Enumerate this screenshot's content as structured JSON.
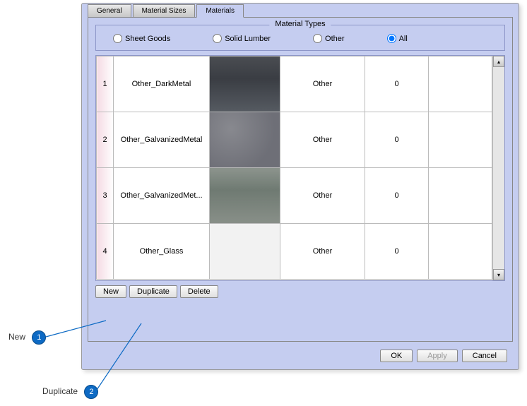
{
  "tabs": {
    "general": "General",
    "sizes": "Material Sizes",
    "materials": "Materials"
  },
  "activeTab": "materials",
  "materialTypes": {
    "legend": "Material Types",
    "options": {
      "sheet": "Sheet Goods",
      "solid": "Solid Lumber",
      "other": "Other",
      "all": "All"
    },
    "selected": "all"
  },
  "rows": [
    {
      "num": "1",
      "name": "Other_DarkMetal",
      "type": "Other",
      "value": "0",
      "swatchClass": "sw1"
    },
    {
      "num": "2",
      "name": "Other_GalvanizedMetal",
      "type": "Other",
      "value": "0",
      "swatchClass": "sw2"
    },
    {
      "num": "3",
      "name": "Other_GalvanizedMet...",
      "type": "Other",
      "value": "0",
      "swatchClass": "sw3"
    },
    {
      "num": "4",
      "name": "Other_Glass",
      "type": "Other",
      "value": "0",
      "swatchClass": "sw4"
    }
  ],
  "actions": {
    "new": "New",
    "duplicate": "Duplicate",
    "delete": "Delete"
  },
  "footer": {
    "ok": "OK",
    "apply": "Apply",
    "cancel": "Cancel"
  },
  "callouts": {
    "new": {
      "label": "New",
      "num": "1"
    },
    "duplicate": {
      "label": "Duplicate",
      "num": "2"
    }
  }
}
